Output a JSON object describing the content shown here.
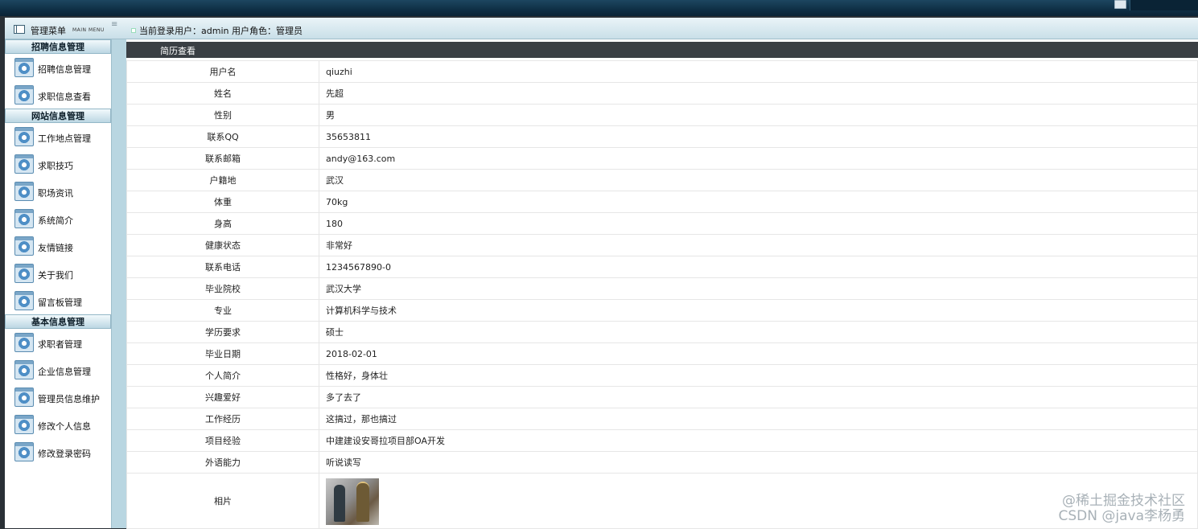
{
  "header": {
    "menu_title": "管理菜单",
    "menu_subtitle": "MAIN MENU",
    "user_info": "当前登录用户：admin  用户角色：管理员"
  },
  "sidebar": {
    "groups": [
      {
        "title": "招聘信息管理",
        "items": [
          "招聘信息管理",
          "求职信息查看"
        ]
      },
      {
        "title": "网站信息管理",
        "items": [
          "工作地点管理",
          "求职技巧",
          "职场资讯",
          "系统简介",
          "友情链接",
          "关于我们",
          "留言板管理"
        ]
      },
      {
        "title": "基本信息管理",
        "items": [
          "求职者管理",
          "企业信息管理",
          "管理员信息维护",
          "修改个人信息",
          "修改登录密码"
        ]
      }
    ]
  },
  "content": {
    "title": "简历查看",
    "rows": [
      {
        "label": "用户名",
        "value": "qiuzhi"
      },
      {
        "label": "姓名",
        "value": "先超"
      },
      {
        "label": "性别",
        "value": "男"
      },
      {
        "label": "联系QQ",
        "value": "35653811"
      },
      {
        "label": "联系邮箱",
        "value": "andy@163.com"
      },
      {
        "label": "户籍地",
        "value": " 武汉"
      },
      {
        "label": "体重",
        "value": "70kg"
      },
      {
        "label": "身高",
        "value": "180"
      },
      {
        "label": "健康状态",
        "value": "非常好"
      },
      {
        "label": "联系电话",
        "value": "1234567890-0"
      },
      {
        "label": "毕业院校",
        "value": "武汉大学"
      },
      {
        "label": "专业",
        "value": "计算机科学与技术"
      },
      {
        "label": "学历要求",
        "value": "硕士"
      },
      {
        "label": "毕业日期",
        "value": "2018-02-01"
      },
      {
        "label": "个人简介",
        "value": "性格好，身体壮"
      },
      {
        "label": "兴趣爱好",
        "value": "多了去了"
      },
      {
        "label": "工作经历",
        "value": "这搞过，那也搞过"
      },
      {
        "label": "项目经验",
        "value": "中建建设安哥拉项目部OA开发"
      },
      {
        "label": "外语能力",
        "value": "听说读写"
      }
    ],
    "photo_label": "相片"
  },
  "watermark": "@稀土掘金技术社区\nCSDN @java李杨勇"
}
